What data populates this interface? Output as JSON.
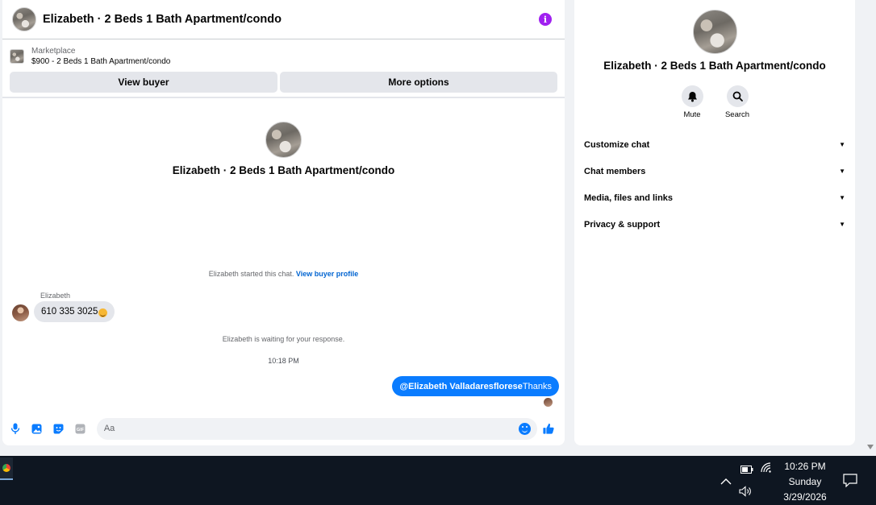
{
  "chat": {
    "title": "Elizabeth · 2 Beds 1 Bath Apartment/condo",
    "marketplace_label": "Marketplace",
    "listing": "$900 - 2 Beds 1 Bath Apartment/condo",
    "view_buyer_label": "View buyer",
    "more_options_label": "More options",
    "intro_title": "Elizabeth · 2 Beds 1 Bath Apartment/condo",
    "started_text": "Elizabeth started this chat.",
    "view_profile_link": "View buyer profile",
    "incoming_sender": "Elizabeth",
    "incoming_message": "610 335 3025",
    "waiting_text": "Elizabeth is waiting for your response.",
    "timestamp": "10:18 PM",
    "outgoing_mention": "@Elizabeth Valladaresflorese",
    "outgoing_text": "Thanks",
    "input_placeholder": "Aa",
    "accent_color": "#0a7cff"
  },
  "details": {
    "title": "Elizabeth · 2 Beds 1 Bath Apartment/condo",
    "mute_label": "Mute",
    "search_label": "Search",
    "sections": [
      {
        "label": "Customize chat"
      },
      {
        "label": "Chat members"
      },
      {
        "label": "Media, files and links"
      },
      {
        "label": "Privacy & support"
      }
    ]
  },
  "taskbar": {
    "time": "10:26 PM",
    "day": "Sunday",
    "date": "3/29/2026"
  }
}
